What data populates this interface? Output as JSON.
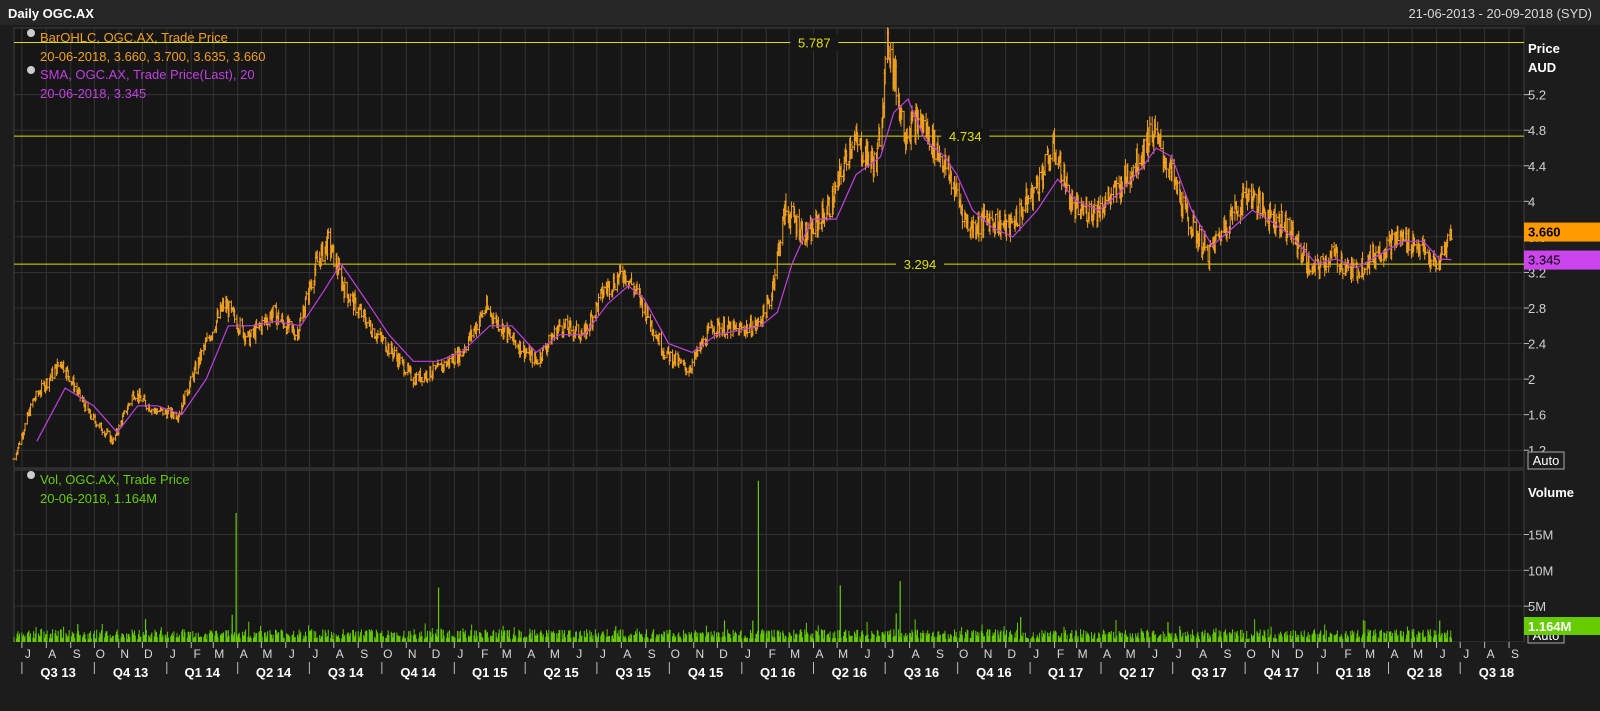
{
  "header": {
    "title": "Daily OGC.AX",
    "date_range": "21-06-2013 - 20-09-2018 (SYD)"
  },
  "legend": {
    "ohlc_name": "BarOHLC, OGC.AX, Trade Price",
    "ohlc_values": "20-06-2018, 3.660, 3.700, 3.635, 3.660",
    "sma_name": "SMA, OGC.AX, Trade Price(Last), 20",
    "sma_values": "20-06-2018, 3.345",
    "vol_name": "Vol, OGC.AX, Trade Price",
    "vol_values": "20-06-2018, 1.164M"
  },
  "axis": {
    "price_title": "Price",
    "price_unit": "AUD",
    "volume_title": "Volume",
    "auto_label": "Auto",
    "last_price_label": "3.660",
    "last_sma_label": "3.345",
    "last_volume_label": "1.164M"
  },
  "colors": {
    "ohlc": "#f0a020",
    "sma": "#c040e0",
    "volume": "#66cc00",
    "hline": "#e0e000",
    "grid": "#333333",
    "last_price_bg": "#ff9900",
    "last_sma_bg": "#cc44ee",
    "last_volume_bg": "#66cc00"
  },
  "chart_data": {
    "type": "line",
    "price": {
      "y_ticks": [
        "5.2",
        "4.8",
        "4.4",
        "4",
        "3.6",
        "3.2",
        "2.8",
        "2.4",
        "2",
        "1.6",
        "1.2"
      ],
      "ylim": [
        1.0,
        5.95
      ],
      "horizontal_lines": [
        {
          "value": 5.787,
          "label": "5.787"
        },
        {
          "value": 4.734,
          "label": "4.734"
        },
        {
          "value": 3.294,
          "label": "3.294"
        }
      ],
      "last_price": 3.66,
      "last_sma": 3.345,
      "series": [
        {
          "name": "BarOHLC, OGC.AX, Trade Price",
          "x": [
            "2013-06-21",
            "2013-07-15",
            "2013-08-20",
            "2013-09-25",
            "2013-10-25",
            "2013-11-20",
            "2013-12-15",
            "2014-01-15",
            "2014-02-15",
            "2014-03-15",
            "2014-04-15",
            "2014-05-15",
            "2014-06-15",
            "2014-07-10",
            "2014-07-25",
            "2014-08-15",
            "2014-09-15",
            "2014-10-15",
            "2014-11-10",
            "2014-12-10",
            "2015-01-10",
            "2015-02-10",
            "2015-03-15",
            "2015-04-15",
            "2015-05-15",
            "2015-06-15",
            "2015-07-10",
            "2015-08-05",
            "2015-08-25",
            "2015-09-25",
            "2015-10-25",
            "2015-11-25",
            "2015-12-25",
            "2016-01-20",
            "2016-02-05",
            "2016-02-25",
            "2016-03-25",
            "2016-04-25",
            "2016-05-20",
            "2016-06-20",
            "2016-07-05",
            "2016-07-25",
            "2016-08-15",
            "2016-09-10",
            "2016-09-25",
            "2016-10-15",
            "2016-11-10",
            "2016-12-05",
            "2017-01-05",
            "2017-02-01",
            "2017-02-25",
            "2017-03-25",
            "2017-04-20",
            "2017-05-20",
            "2017-06-05",
            "2017-06-25",
            "2017-07-20",
            "2017-08-15",
            "2017-09-10",
            "2017-10-05",
            "2017-10-25",
            "2017-11-25",
            "2017-12-25",
            "2018-01-20",
            "2018-02-15",
            "2018-03-15",
            "2018-04-15",
            "2018-05-10",
            "2018-06-01",
            "2018-06-20"
          ],
          "values": [
            1.1,
            1.75,
            2.2,
            1.6,
            1.3,
            1.85,
            1.65,
            1.6,
            2.3,
            2.85,
            2.45,
            2.75,
            2.5,
            3.3,
            3.55,
            3.0,
            2.6,
            2.3,
            2.0,
            2.1,
            2.3,
            2.8,
            2.45,
            2.2,
            2.6,
            2.5,
            3.0,
            3.2,
            2.9,
            2.3,
            2.1,
            2.6,
            2.55,
            2.6,
            2.85,
            3.9,
            3.6,
            4.0,
            4.7,
            4.4,
            5.8,
            4.8,
            4.9,
            4.5,
            4.2,
            3.7,
            3.8,
            3.7,
            4.1,
            4.6,
            3.9,
            3.9,
            4.1,
            4.5,
            4.8,
            4.4,
            3.8,
            3.4,
            3.8,
            4.1,
            3.9,
            3.7,
            3.2,
            3.4,
            3.2,
            3.4,
            3.6,
            3.5,
            3.25,
            3.66
          ]
        },
        {
          "name": "SMA, OGC.AX, Trade Price(Last), 20",
          "x": [
            "2013-07-20",
            "2013-08-25",
            "2013-09-30",
            "2013-10-30",
            "2013-11-25",
            "2013-12-20",
            "2014-01-20",
            "2014-02-20",
            "2014-03-20",
            "2014-04-20",
            "2014-05-20",
            "2014-06-20",
            "2014-07-20",
            "2014-08-10",
            "2014-09-10",
            "2014-10-10",
            "2014-11-10",
            "2014-12-10",
            "2015-01-10",
            "2015-02-15",
            "2015-03-15",
            "2015-04-15",
            "2015-05-15",
            "2015-06-15",
            "2015-07-15",
            "2015-08-10",
            "2015-08-30",
            "2015-09-30",
            "2015-10-30",
            "2015-11-30",
            "2015-12-30",
            "2016-01-25",
            "2016-02-15",
            "2016-03-05",
            "2016-03-30",
            "2016-04-30",
            "2016-05-25",
            "2016-06-25",
            "2016-07-12",
            "2016-07-30",
            "2016-08-20",
            "2016-09-15",
            "2016-09-30",
            "2016-10-20",
            "2016-11-15",
            "2016-12-10",
            "2017-01-10",
            "2017-02-05",
            "2017-03-01",
            "2017-03-30",
            "2017-04-25",
            "2017-05-25",
            "2017-06-10",
            "2017-06-30",
            "2017-07-25",
            "2017-08-20",
            "2017-09-15",
            "2017-10-10",
            "2017-10-30",
            "2017-11-30",
            "2017-12-30",
            "2018-01-25",
            "2018-02-20",
            "2018-03-20",
            "2018-04-20",
            "2018-05-15",
            "2018-06-05",
            "2018-06-20"
          ],
          "values": [
            1.3,
            1.9,
            1.7,
            1.4,
            1.7,
            1.7,
            1.6,
            2.0,
            2.6,
            2.6,
            2.65,
            2.6,
            3.0,
            3.3,
            2.9,
            2.5,
            2.2,
            2.2,
            2.3,
            2.6,
            2.6,
            2.3,
            2.5,
            2.5,
            2.85,
            3.05,
            2.9,
            2.4,
            2.3,
            2.5,
            2.55,
            2.6,
            2.75,
            3.3,
            3.8,
            3.8,
            4.3,
            4.5,
            5.0,
            5.15,
            4.7,
            4.5,
            4.3,
            3.9,
            3.7,
            3.6,
            3.9,
            4.25,
            4.0,
            3.9,
            4.1,
            4.4,
            4.6,
            4.5,
            3.9,
            3.5,
            3.7,
            3.9,
            3.8,
            3.6,
            3.3,
            3.35,
            3.25,
            3.4,
            3.55,
            3.55,
            3.35,
            3.345
          ]
        }
      ]
    },
    "volume": {
      "y_ticks": [
        "15M",
        "10M",
        "5M"
      ],
      "ylim": [
        0,
        24
      ],
      "last_volume": 1.164,
      "spikes": [
        {
          "x": "2013-09-10",
          "value": 2.5
        },
        {
          "x": "2013-12-05",
          "value": 3.2
        },
        {
          "x": "2014-03-30",
          "value": 18.0
        },
        {
          "x": "2014-03-25",
          "value": 3.8
        },
        {
          "x": "2014-12-12",
          "value": 7.6
        },
        {
          "x": "2015-07-25",
          "value": 2.2
        },
        {
          "x": "2015-12-10",
          "value": 3.0
        },
        {
          "x": "2016-01-22",
          "value": 22.5
        },
        {
          "x": "2016-01-15",
          "value": 3.0
        },
        {
          "x": "2016-05-05",
          "value": 7.9
        },
        {
          "x": "2016-07-20",
          "value": 8.5
        },
        {
          "x": "2016-07-15",
          "value": 4.0
        },
        {
          "x": "2016-12-20",
          "value": 3.5
        },
        {
          "x": "2017-06-25",
          "value": 2.8
        },
        {
          "x": "2018-06-05",
          "value": 3.0
        }
      ]
    },
    "x_month_labels": [
      "J",
      "A",
      "S",
      "O",
      "N",
      "D",
      "J",
      "F",
      "M",
      "A",
      "M",
      "J",
      "J",
      "A",
      "S",
      "O",
      "N",
      "D",
      "J",
      "F",
      "M",
      "A",
      "M",
      "J",
      "J",
      "A",
      "S",
      "O",
      "N",
      "D",
      "J",
      "F",
      "M",
      "A",
      "M",
      "J",
      "J",
      "A",
      "S",
      "O",
      "N",
      "D",
      "J",
      "F",
      "M",
      "A",
      "M",
      "J",
      "J",
      "A",
      "S",
      "O",
      "N",
      "D",
      "J",
      "F",
      "M",
      "A",
      "M",
      "J",
      "J",
      "A",
      "S"
    ],
    "x_quarter_labels": [
      "Q3 13",
      "Q4 13",
      "Q1 14",
      "Q2 14",
      "Q3 14",
      "Q4 14",
      "Q1 15",
      "Q2 15",
      "Q3 15",
      "Q4 15",
      "Q1 16",
      "Q2 16",
      "Q3 16",
      "Q4 16",
      "Q1 17",
      "Q2 17",
      "Q3 17",
      "Q4 17",
      "Q1 18",
      "Q2 18",
      "Q3 18"
    ],
    "xlim": [
      "2013-06-21",
      "2018-09-20"
    ],
    "grid": true
  }
}
